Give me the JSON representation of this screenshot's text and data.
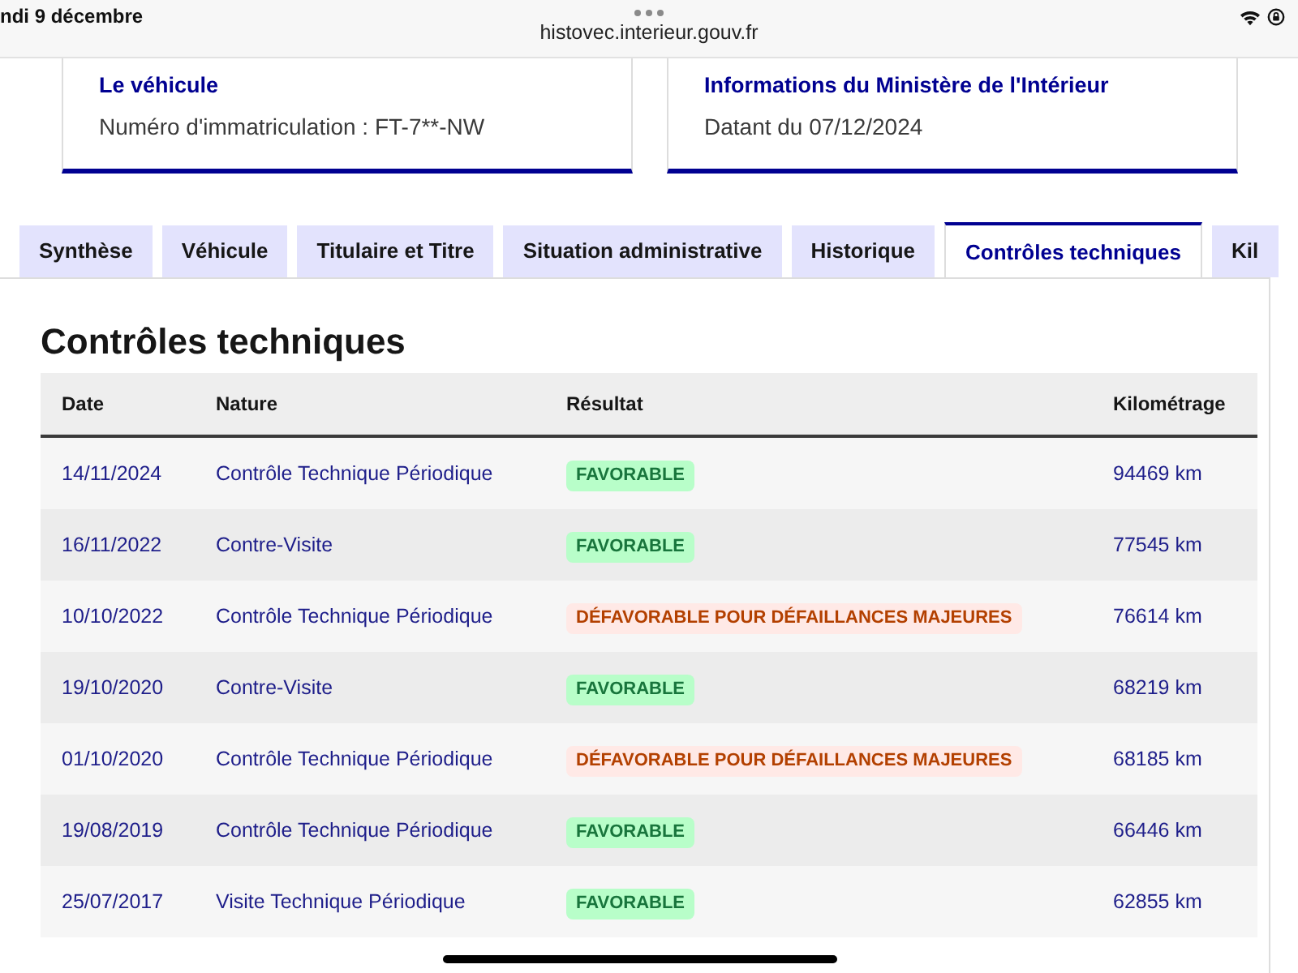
{
  "status_bar": {
    "date": "ndi 9 décembre",
    "url": "histovec.interieur.gouv.fr"
  },
  "cards": [
    {
      "title": "Le véhicule",
      "text": "Numéro d'immatriculation : FT-7**-NW"
    },
    {
      "title": "Informations du Ministère de l'Intérieur",
      "text": "Datant du 07/12/2024"
    }
  ],
  "tabs": [
    {
      "label": "Synthèse",
      "selected": false
    },
    {
      "label": "Véhicule",
      "selected": false
    },
    {
      "label": "Titulaire et Titre",
      "selected": false
    },
    {
      "label": "Situation administrative",
      "selected": false
    },
    {
      "label": "Historique",
      "selected": false
    },
    {
      "label": "Contrôles techniques",
      "selected": true
    },
    {
      "label": "Kil",
      "selected": false
    }
  ],
  "section": {
    "title": "Contrôles techniques"
  },
  "table": {
    "columns": [
      "Date",
      "Nature",
      "Résultat",
      "Kilométrage"
    ],
    "rows": [
      {
        "date": "14/11/2024",
        "nature": "Contrôle Technique Périodique",
        "result": {
          "label": "FAVORABLE",
          "kind": "favorable"
        },
        "mileage": "94469 km"
      },
      {
        "date": "16/11/2022",
        "nature": "Contre-Visite",
        "result": {
          "label": "FAVORABLE",
          "kind": "favorable"
        },
        "mileage": "77545 km"
      },
      {
        "date": "10/10/2022",
        "nature": "Contrôle Technique Périodique",
        "result": {
          "label": "DÉFAVORABLE POUR DÉFAILLANCES MAJEURES",
          "kind": "defavorable"
        },
        "mileage": "76614 km"
      },
      {
        "date": "19/10/2020",
        "nature": "Contre-Visite",
        "result": {
          "label": "FAVORABLE",
          "kind": "favorable"
        },
        "mileage": "68219 km"
      },
      {
        "date": "01/10/2020",
        "nature": "Contrôle Technique Périodique",
        "result": {
          "label": "DÉFAVORABLE POUR DÉFAILLANCES MAJEURES",
          "kind": "defavorable"
        },
        "mileage": "68185 km"
      },
      {
        "date": "19/08/2019",
        "nature": "Contrôle Technique Périodique",
        "result": {
          "label": "FAVORABLE",
          "kind": "favorable"
        },
        "mileage": "66446 km"
      },
      {
        "date": "25/07/2017",
        "nature": "Visite Technique Périodique",
        "result": {
          "label": "FAVORABLE",
          "kind": "favorable"
        },
        "mileage": "62855 km"
      }
    ]
  }
}
